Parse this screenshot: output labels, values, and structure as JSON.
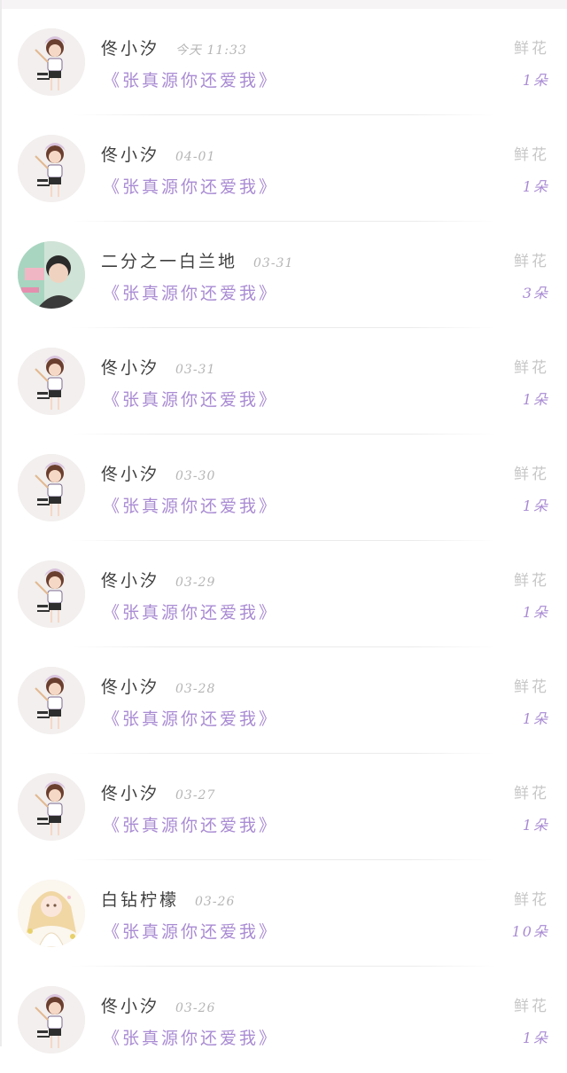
{
  "gift_type": "鲜花",
  "items": [
    {
      "user": "佟小汐",
      "date": "今天 11:33",
      "title": "《张真源你还爱我》",
      "count": "1朵",
      "avatar": "girl-avatar"
    },
    {
      "user": "佟小汐",
      "date": "04-01",
      "title": "《张真源你还爱我》",
      "count": "1朵",
      "avatar": "girl-avatar"
    },
    {
      "user": "二分之一白兰地",
      "date": "03-31",
      "title": "《张真源你还爱我》",
      "count": "3朵",
      "avatar": "boy-photo-avatar"
    },
    {
      "user": "佟小汐",
      "date": "03-31",
      "title": "《张真源你还爱我》",
      "count": "1朵",
      "avatar": "girl-avatar"
    },
    {
      "user": "佟小汐",
      "date": "03-30",
      "title": "《张真源你还爱我》",
      "count": "1朵",
      "avatar": "girl-avatar"
    },
    {
      "user": "佟小汐",
      "date": "03-29",
      "title": "《张真源你还爱我》",
      "count": "1朵",
      "avatar": "girl-avatar"
    },
    {
      "user": "佟小汐",
      "date": "03-28",
      "title": "《张真源你还爱我》",
      "count": "1朵",
      "avatar": "girl-avatar"
    },
    {
      "user": "佟小汐",
      "date": "03-27",
      "title": "《张真源你还爱我》",
      "count": "1朵",
      "avatar": "girl-avatar"
    },
    {
      "user": "白钻柠檬",
      "date": "03-26",
      "title": "《张真源你还爱我》",
      "count": "10朵",
      "avatar": "anime-girl-avatar"
    },
    {
      "user": "佟小汐",
      "date": "03-26",
      "title": "《张真源你还爱我》",
      "count": "1朵",
      "avatar": "girl-avatar"
    }
  ],
  "colors": {
    "accent_purple": "#a98bd3",
    "name_text": "#3f3f3f",
    "muted_text": "#b5b5b5"
  }
}
